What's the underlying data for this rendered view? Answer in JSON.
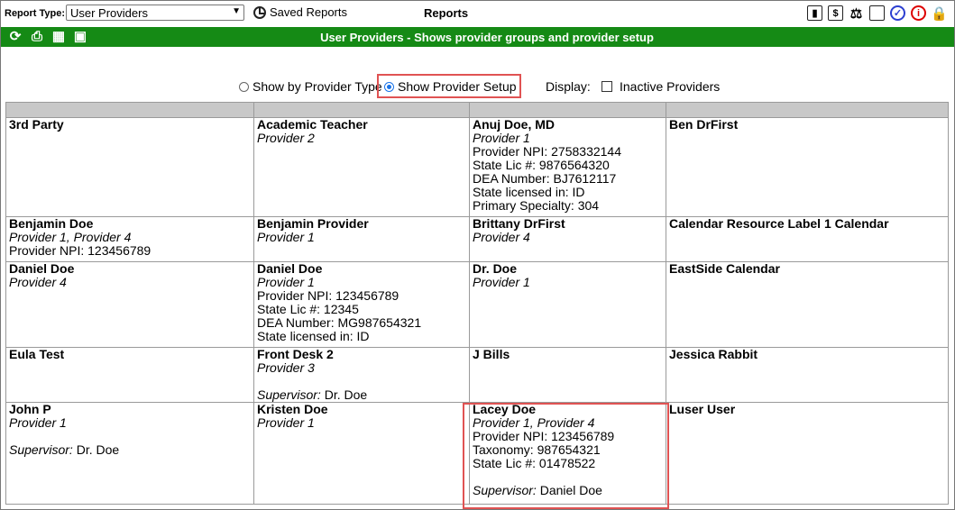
{
  "topbar": {
    "report_type_label": "Report Type:",
    "report_type_value": "User Providers",
    "saved_reports": "Saved Reports",
    "title": "Reports",
    "icons": [
      "chart-icon",
      "invoice-icon",
      "lab-icon",
      "note-icon",
      "check-circle-icon",
      "info-icon",
      "lock-icon"
    ]
  },
  "greenbar": {
    "title": "User Providers - Shows provider groups and provider setup",
    "icons": [
      "refresh-icon",
      "print-icon",
      "excel-icon",
      "save-icon"
    ]
  },
  "options": {
    "by_type": "Show by Provider Type",
    "setup": "Show Provider Setup",
    "display": "Display:",
    "inactive": "Inactive Providers"
  },
  "rows": [
    [
      {
        "name": "3rd Party",
        "group": "",
        "lines": []
      },
      {
        "name": "Academic Teacher",
        "group": "Provider 2",
        "lines": []
      },
      {
        "name": "Anuj Doe, MD",
        "group": "Provider 1",
        "lines": [
          "Provider NPI: 2758332144",
          "State Lic #: 9876564320",
          "DEA Number: BJ7612117",
          "State licensed in: ID",
          "Primary Specialty: 304"
        ]
      },
      {
        "name": "Ben DrFirst",
        "group": "",
        "lines": []
      }
    ],
    [
      {
        "name": "Benjamin Doe",
        "group": "Provider 1, Provider 4",
        "lines": [
          "Provider NPI: 123456789"
        ]
      },
      {
        "name": "Benjamin Provider",
        "group": "Provider 1",
        "lines": []
      },
      {
        "name": "Brittany DrFirst",
        "group": "Provider 4",
        "lines": []
      },
      {
        "name": "Calendar Resource Label 1 Calendar",
        "group": "",
        "lines": []
      }
    ],
    [
      {
        "name": "Daniel Doe",
        "group": "Provider 4",
        "lines": []
      },
      {
        "name": "Daniel Doe",
        "group": "Provider 1",
        "lines": [
          "Provider NPI: 123456789",
          "State Lic #: 12345",
          "DEA Number: MG987654321",
          "State licensed in: ID"
        ]
      },
      {
        "name": "Dr. Doe",
        "group": "Provider 1",
        "lines": []
      },
      {
        "name": "EastSide Calendar",
        "group": "",
        "lines": []
      }
    ],
    [
      {
        "name": "Eula Test",
        "group": "",
        "lines": []
      },
      {
        "name": "Front Desk 2",
        "group": "Provider 3",
        "lines": [],
        "supervisor": "Dr. Doe"
      },
      {
        "name": "J Bills",
        "group": "",
        "lines": []
      },
      {
        "name": "Jessica Rabbit",
        "group": "",
        "lines": []
      }
    ],
    [
      {
        "name": "John P",
        "group": "Provider 1",
        "lines": [],
        "supervisor": "Dr. Doe"
      },
      {
        "name": "Kristen Doe",
        "group": "Provider 1",
        "lines": []
      },
      {
        "name": "Lacey Doe",
        "group": "Provider 1, Provider 4",
        "lines": [
          "Provider NPI: 123456789",
          "Taxonomy: 987654321",
          "State Lic #: 01478522"
        ],
        "supervisor": "Daniel Doe"
      },
      {
        "name": "Luser User",
        "group": "",
        "lines": []
      }
    ]
  ],
  "supervisor_label": "Supervisor:"
}
